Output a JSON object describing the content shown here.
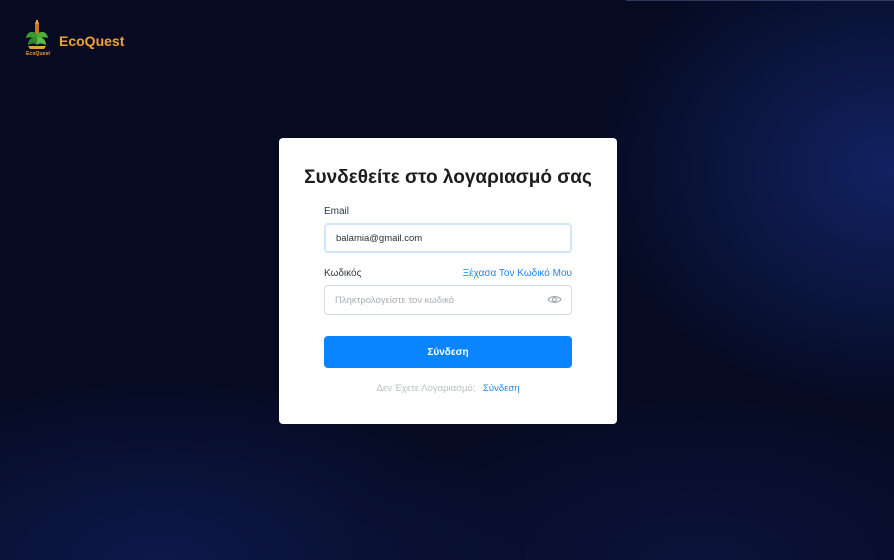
{
  "brand": {
    "name": "EcoQuest",
    "logo_caption": "EcoQuest",
    "logo_icon": "ecoquest-logo-icon"
  },
  "login": {
    "title": "Συνδεθείτε στο λογαριασμό σας",
    "email_label": "Email",
    "email_value": "balamia@gmail.com",
    "password_label": "Κωδικός",
    "forgot_link": "Ξέχασα Τον Κωδικό Μου",
    "password_placeholder": "Πληκτρολογείστε τον κωδικό",
    "password_toggle_icon": "eye-icon",
    "submit_label": "Σύνδεση",
    "no_account_text": "Δεν  Έχετε Λογαριασμό;",
    "signup_link": "Σύνδεση"
  },
  "colors": {
    "background": "#060b22",
    "brand_orange": "#f0a238",
    "accent_blue": "#0a84ff",
    "link_blue": "#1d86f0"
  }
}
